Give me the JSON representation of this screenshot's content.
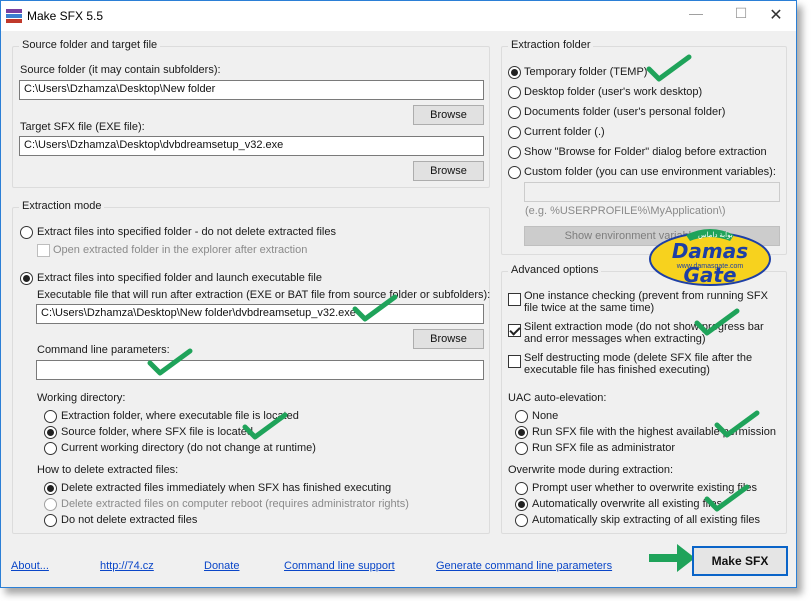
{
  "window": {
    "title": "Make SFX 5.5"
  },
  "source_group": {
    "legend": "Source folder and target file",
    "source_label": "Source folder (it may contain subfolders):",
    "source_value": "C:\\Users\\Dzhamza\\Desktop\\New folder",
    "browse1": "Browse",
    "target_label": "Target SFX file (EXE file):",
    "target_value": "C:\\Users\\Dzhamza\\Desktop\\dvbdreamsetup_v32.exe",
    "browse2": "Browse"
  },
  "extraction_mode": {
    "legend": "Extraction mode",
    "option1": "Extract files into specified folder - do not delete extracted files",
    "open_folder": "Open extracted folder in the explorer after extraction",
    "option2": "Extract files into specified folder and launch executable file",
    "exe_label": "Executable file that will run after extraction (EXE or BAT file from source folder or subfolders):",
    "exe_value": "C:\\Users\\Dzhamza\\Desktop\\New folder\\dvbdreamsetup_v32.exe",
    "browse3": "Browse",
    "cmd_label": "Command line parameters:",
    "cmd_value": "",
    "working_dir_label": "Working directory:",
    "wd_options": [
      "Extraction folder, where executable file is located",
      "Source folder, where SFX file is located",
      "Current working directory (do not change at runtime)"
    ],
    "delete_label": "How to delete extracted files:",
    "delete_options": [
      "Delete extracted files immediately when SFX has finished executing",
      "Delete extracted files on computer reboot (requires administrator rights)",
      "Do not delete extracted files"
    ]
  },
  "extraction_folder": {
    "legend": "Extraction folder",
    "options": [
      "Temporary folder (TEMP)",
      "Desktop folder (user's work desktop)",
      "Documents folder (user's personal folder)",
      "Current folder (.)",
      "Show \"Browse for Folder\" dialog before extraction",
      "Custom folder (you can use environment variables):"
    ],
    "custom_value": "",
    "example": "(e.g. %USERPROFILE%\\MyApplication\\)",
    "show_env": "Show environment variables on th..."
  },
  "advanced": {
    "legend": "Advanced options",
    "one_instance": "One instance checking (prevent from running SFX file twice at the same time)",
    "silent": "Silent extraction mode (do not show progress bar and error messages when extracting)",
    "self_destruct": "Self destructing mode (delete SFX file after the executable file has finished executing)",
    "uac_label": "UAC auto-elevation:",
    "uac_options": [
      "None",
      "Run SFX file with the highest available permission",
      "Run SFX file as administrator"
    ],
    "overwrite_label": "Overwrite mode during extraction:",
    "overwrite_options": [
      "Prompt user whether to overwrite existing files",
      "Automatically overwrite all existing files",
      "Automatically skip extracting of all existing files"
    ]
  },
  "footer": {
    "about": "About...",
    "site": "http://74.cz",
    "donate": "Donate",
    "cmd_support": "Command line support",
    "gen_params": "Generate command line parameters",
    "make": "Make SFX"
  },
  "watermark": {
    "name": "Damas Gate",
    "url": "www.damasgate.com",
    "arabic": "بوابة داماس"
  },
  "colors": {
    "accent": "#0a64c8",
    "tick": "#1fa35a",
    "link": "#0a46c8"
  }
}
